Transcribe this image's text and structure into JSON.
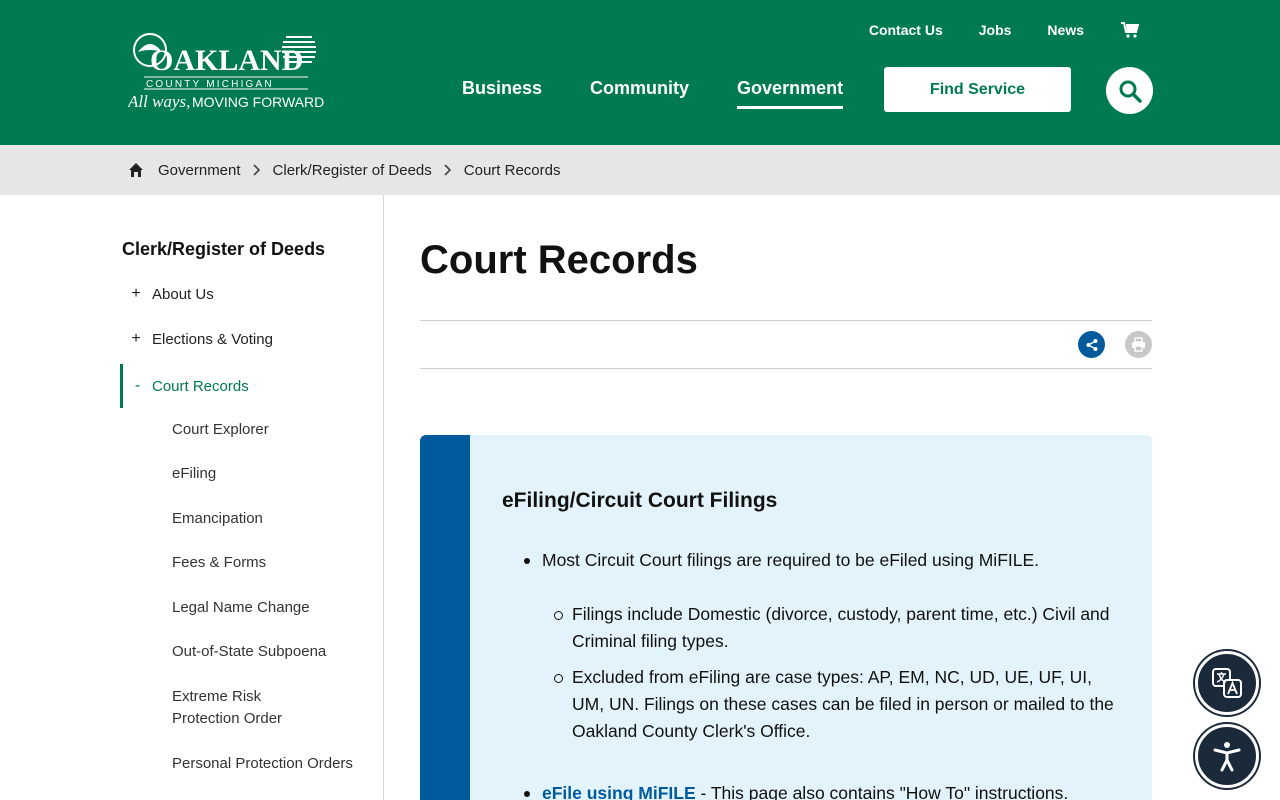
{
  "header": {
    "logo": {
      "name": "OAKLAND",
      "subtitle": "COUNTY MICHIGAN",
      "tagline_script": "All ways,",
      "tagline": "MOVING FORWARD"
    },
    "utility": [
      "Contact Us",
      "Jobs",
      "News"
    ],
    "nav": [
      {
        "label": "Business",
        "active": false
      },
      {
        "label": "Community",
        "active": false
      },
      {
        "label": "Government",
        "active": true
      }
    ],
    "find_service": "Find Service",
    "colors": {
      "brand": "#007a51",
      "accent": "#005a9c"
    }
  },
  "breadcrumb": [
    "Government",
    "Clerk/Register of Deeds",
    "Court Records"
  ],
  "sidebar": {
    "title": "Clerk/Register of Deeds",
    "items": [
      {
        "symbol": "+",
        "label": "About Us"
      },
      {
        "symbol": "+",
        "label": "Elections & Voting"
      },
      {
        "symbol": "-",
        "label": "Court Records"
      }
    ],
    "subitems": [
      "Court Explorer",
      "eFiling",
      "Emancipation",
      "Fees & Forms",
      "Legal Name Change",
      "Out-of-State Subpoena",
      "Extreme Risk Protection Order",
      "Personal Protection Orders"
    ]
  },
  "main": {
    "title": "Court Records",
    "callout": {
      "heading": "eFiling/Circuit Court Filings",
      "bullet1": "Most Circuit Court filings are required to be eFiled using MiFILE.",
      "sub1": "Filings include Domestic (divorce, custody, parent time, etc.) Civil and Criminal filing types.",
      "sub2": "Excluded from eFiling are case types: AP, EM, NC, UD, UE, UF, UI, UM, UN. Filings on these cases can be filed in person or mailed to the Oakland County Clerk's Office.",
      "link_text": "eFile using MiFILE",
      "link_suffix": " - This page also contains \"How To\" instructions."
    }
  }
}
